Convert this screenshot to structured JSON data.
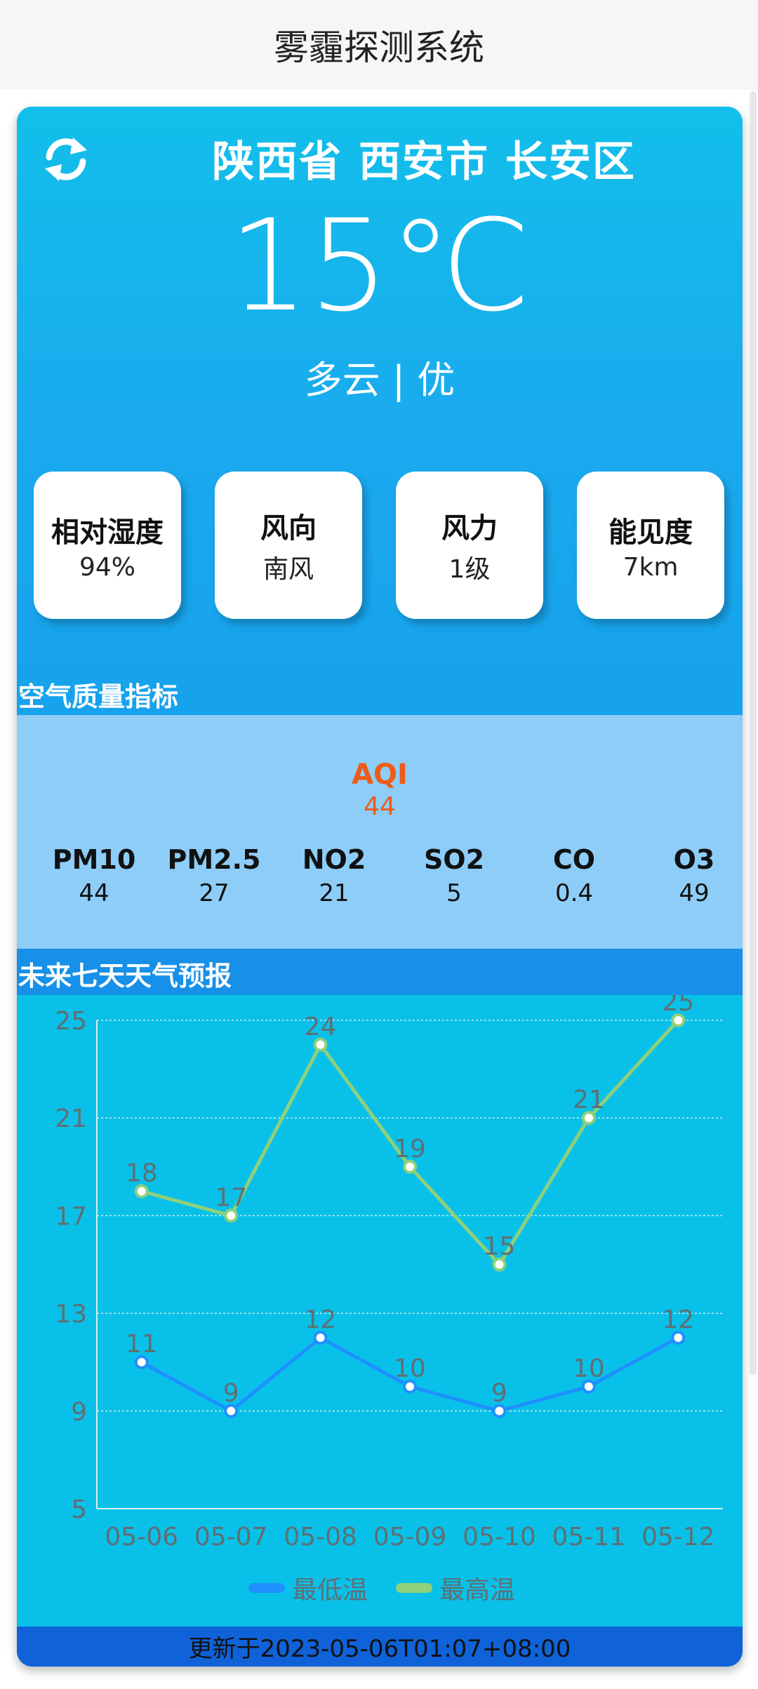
{
  "app": {
    "title": "雾霾探测系统"
  },
  "weather": {
    "location": "陕西省 西安市 长安区",
    "temperature": "15℃",
    "condition": "多云 | 优"
  },
  "tiles": [
    {
      "label": "相对湿度",
      "value": "94%"
    },
    {
      "label": "风向",
      "value": "南风"
    },
    {
      "label": "风力",
      "value": "1级"
    },
    {
      "label": "能见度",
      "value": "7km"
    }
  ],
  "air_quality": {
    "section_title": "空气质量指标",
    "aqi_label": "AQI",
    "aqi_value": "44",
    "aqi_color": "#ef5b17",
    "pollutants": [
      {
        "name": "PM10",
        "value": "44"
      },
      {
        "name": "PM2.5",
        "value": "27"
      },
      {
        "name": "NO2",
        "value": "21"
      },
      {
        "name": "SO2",
        "value": "5"
      },
      {
        "name": "CO",
        "value": "0.4"
      },
      {
        "name": "O3",
        "value": "49"
      }
    ]
  },
  "forecast": {
    "section_title": "未来七天天气预报"
  },
  "chart_data": {
    "type": "line",
    "categories": [
      "05-06",
      "05-07",
      "05-08",
      "05-09",
      "05-10",
      "05-11",
      "05-12"
    ],
    "series": [
      {
        "name": "最低温",
        "values": [
          11,
          9,
          12,
          10,
          9,
          10,
          12
        ],
        "color": "#1e90ff"
      },
      {
        "name": "最高温",
        "values": [
          18,
          17,
          24,
          19,
          15,
          21,
          25
        ],
        "color": "#8fd07a"
      }
    ],
    "yticks": [
      5,
      9,
      13,
      17,
      21,
      25
    ],
    "ylim": [
      5,
      25
    ],
    "grid": true,
    "legend": "bottom",
    "data_labels": true
  },
  "footer": {
    "updated": "更新于2023-05-06T01:07+08:00"
  }
}
